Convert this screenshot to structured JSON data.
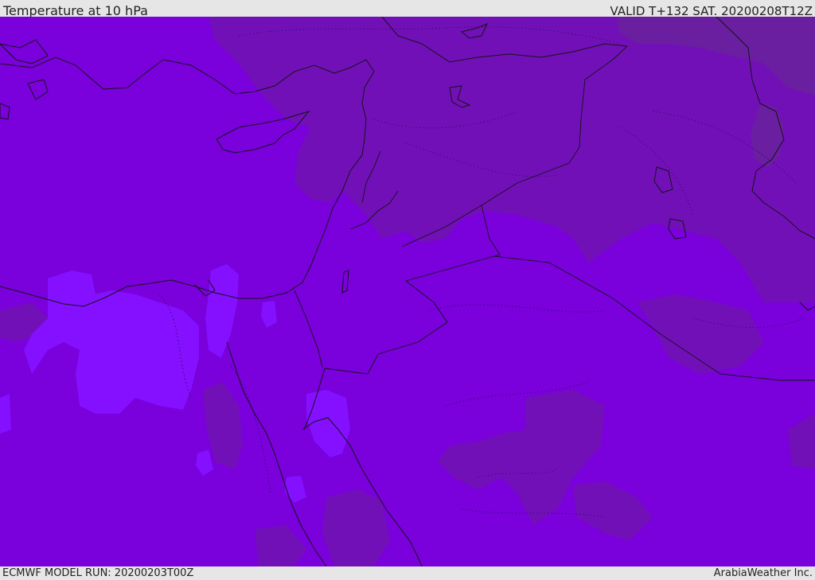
{
  "header": {
    "title": "Temperature at 10 hPa",
    "valid_time": "VALID T+132 SAT. 20200208T12Z"
  },
  "footer": {
    "model_run": "ECMWF MODEL RUN: 20200203T00Z",
    "credit": "ArabiaWeather Inc."
  },
  "map": {
    "colors": {
      "base": "#7a00dc",
      "warm_band": "#7210b8",
      "warmest_band": "#6a1ea0",
      "cool_band": "#8410ff",
      "coast": "#141414",
      "border": "#141414"
    }
  }
}
